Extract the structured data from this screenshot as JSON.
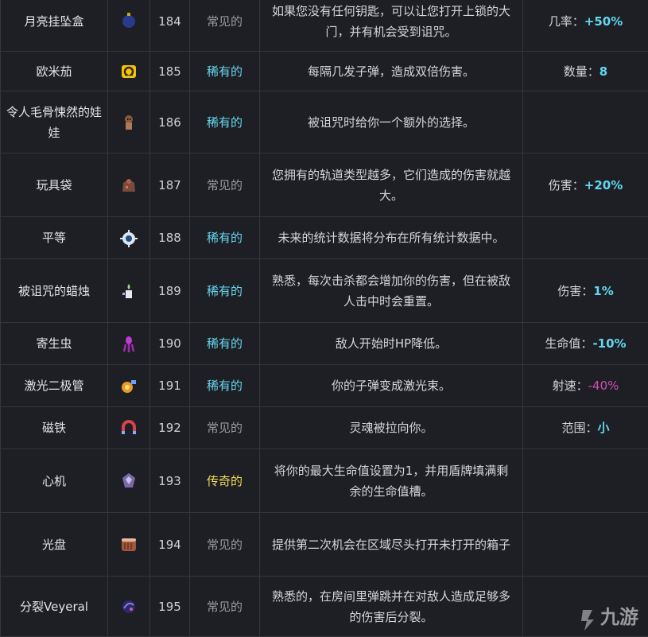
{
  "rows": [
    {
      "name": "月亮挂坠盒",
      "icon": "moon-locket-icon",
      "id": "184",
      "rarity": "常见的",
      "rarity_class": "common",
      "desc": "如果您没有任何钥匙，可以让您打开上锁的大门，并有机会受到诅咒。",
      "stat_label": "几率：",
      "stat_value": "+50%",
      "stat_color": "pos"
    },
    {
      "name": "欧米茄",
      "icon": "omega-icon",
      "id": "185",
      "rarity": "稀有的",
      "rarity_class": "rare",
      "desc": "每隔几发子弹，造成双倍伤害。",
      "stat_label": "数量：",
      "stat_value": "8",
      "stat_color": "pos"
    },
    {
      "name": "令人毛骨悚然的娃娃",
      "icon": "creepy-doll-icon",
      "id": "186",
      "rarity": "稀有的",
      "rarity_class": "rare",
      "desc": "被诅咒时给你一个额外的选择。",
      "stat_label": "",
      "stat_value": "",
      "stat_color": "pos"
    },
    {
      "name": "玩具袋",
      "icon": "toy-bag-icon",
      "id": "187",
      "rarity": "常见的",
      "rarity_class": "common",
      "desc": "您拥有的轨道类型越多，它们造成的伤害就越大。",
      "stat_label": "伤害：",
      "stat_value": "+20%",
      "stat_color": "pos"
    },
    {
      "name": "平等",
      "icon": "equality-icon",
      "id": "188",
      "rarity": "稀有的",
      "rarity_class": "rare",
      "desc": "未来的统计数据将分布在所有统计数据中。",
      "stat_label": "",
      "stat_value": "",
      "stat_color": "pos"
    },
    {
      "name": "被诅咒的蜡烛",
      "icon": "cursed-candle-icon",
      "id": "189",
      "rarity": "稀有的",
      "rarity_class": "rare",
      "desc": "熟悉，每次击杀都会增加你的伤害，但在被敌人击中时会重置。",
      "stat_label": "伤害：",
      "stat_value": "1%",
      "stat_color": "pos"
    },
    {
      "name": "寄生虫",
      "icon": "parasite-icon",
      "id": "190",
      "rarity": "稀有的",
      "rarity_class": "rare",
      "desc": "敌人开始时HP降低。",
      "stat_label": "生命值：",
      "stat_value": "-10%",
      "stat_color": "pos"
    },
    {
      "name": "激光二极管",
      "icon": "laser-diode-icon",
      "id": "191",
      "rarity": "稀有的",
      "rarity_class": "rare",
      "desc": "你的子弹变成激光束。",
      "stat_label": "射速：",
      "stat_value": "-40%",
      "stat_color": "neg"
    },
    {
      "name": "磁铁",
      "icon": "magnet-icon",
      "id": "192",
      "rarity": "常见的",
      "rarity_class": "common",
      "desc": "灵魂被拉向你。",
      "stat_label": "范围：",
      "stat_value": "小",
      "stat_color": "pos"
    },
    {
      "name": "心机",
      "icon": "scheme-icon",
      "id": "193",
      "rarity": "传奇的",
      "rarity_class": "legend",
      "desc": "将你的最大生命值设置为1，并用盾牌填满剩余的生命值槽。",
      "stat_label": "",
      "stat_value": "",
      "stat_color": "pos"
    },
    {
      "name": "光盘",
      "icon": "disc-icon",
      "id": "194",
      "rarity": "常见的",
      "rarity_class": "common",
      "desc": "提供第二次机会在区域尽头打开未打开的箱子",
      "stat_label": "",
      "stat_value": "",
      "stat_color": "pos"
    },
    {
      "name": "分裂Veyeral",
      "icon": "split-veyeral-icon",
      "id": "195",
      "rarity": "常见的",
      "rarity_class": "common",
      "desc": "熟悉的，在房间里弹跳并在对敌人造成足够多的伤害后分裂。",
      "stat_label": "",
      "stat_value": "",
      "stat_color": "pos"
    }
  ],
  "watermark": {
    "text": "九游"
  }
}
